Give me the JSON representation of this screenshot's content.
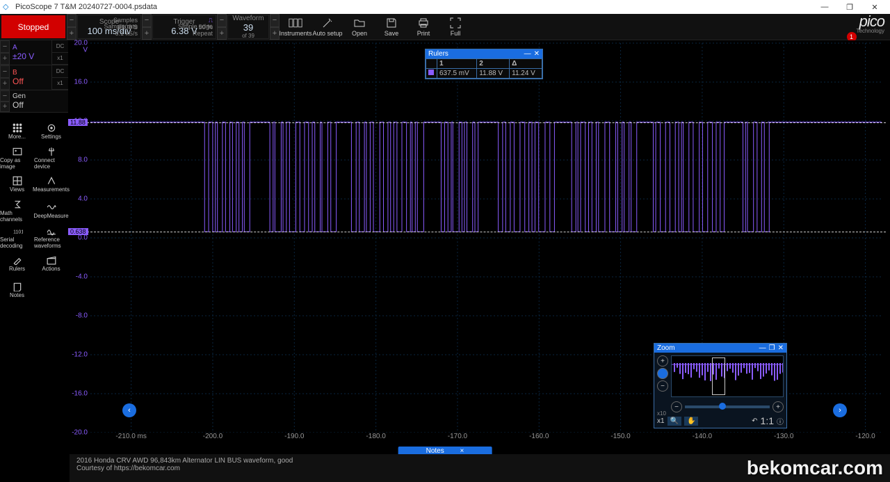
{
  "window": {
    "title": "PicoScope 7 T&M 20240727-0004.psdata",
    "controls": {
      "min": "—",
      "max": "❐",
      "close": "✕"
    }
  },
  "toolbar": {
    "status": "Stopped",
    "scope": {
      "title": "Scope",
      "value": "100 ms/div",
      "samples_lbl": "Samples",
      "samples": "6108 S",
      "rate_lbl": "Sample rate",
      "rate": "6.1 kS/s"
    },
    "trigger": {
      "title": "Trigger",
      "value": "6.38 V",
      "pct": "50 %",
      "edge": "Simple edge",
      "repeat": "Repeat"
    },
    "waveform": {
      "title": "Waveform",
      "value": "39",
      "of": "of 39"
    },
    "buttons": {
      "instruments": "Instruments",
      "autosetup": "Auto setup",
      "open": "Open",
      "save": "Save",
      "print": "Print",
      "full": "Full"
    },
    "logo": "pico",
    "logo_sub": "Technology",
    "badge": "1"
  },
  "channels": {
    "A": {
      "name": "A",
      "range": "±20 V",
      "coupling": "DC",
      "x": "x1"
    },
    "B": {
      "name": "B",
      "range": "Off",
      "coupling": "DC",
      "x": "x1"
    },
    "Gen": {
      "name": "Gen",
      "state": "Off"
    }
  },
  "sidebar": {
    "more": "More...",
    "settings": "Settings",
    "copy": "Copy as image",
    "connect": "Connect device",
    "views": "Views",
    "measurements": "Measurements",
    "math": "Math channels",
    "deep": "DeepMeasure",
    "serial": "Serial decoding",
    "refwave": "Reference waveforms",
    "rulers": "Rulers",
    "actions": "Actions",
    "notes": "Notes"
  },
  "chart_data": {
    "type": "line",
    "title": "",
    "series_name": "Channel A",
    "color": "#8a5cff",
    "y_unit": "V",
    "x_unit": "ms",
    "y_ticks": [
      20.0,
      16.0,
      12.0,
      8.0,
      4.0,
      0.0,
      -4.0,
      -8.0,
      -12.0,
      -16.0,
      -20.0
    ],
    "y_unit_label": "V",
    "x_ticks": [
      -210.0,
      -200.0,
      -190.0,
      -180.0,
      -170.0,
      -160.0,
      -150.0,
      -140.0,
      -130.0,
      -120.0
    ],
    "x_unit_label": "ms",
    "ylim": [
      -20.0,
      20.0
    ],
    "xlim": [
      -215.0,
      -118.0
    ],
    "high_level": 11.88,
    "low_level": 0.638,
    "ruler1": {
      "label": "0.638",
      "value": 0.638
    },
    "ruler2": {
      "label": "11.88",
      "value": 11.88
    }
  },
  "rulers_panel": {
    "title": "Rulers",
    "close": "✕",
    "min": "—",
    "headers": [
      "",
      "1",
      "2",
      "Δ"
    ],
    "row": [
      "637.5 mV",
      "11.88 V",
      "11.24 V"
    ]
  },
  "zoom_panel": {
    "title": "Zoom",
    "close": "✕",
    "min": "—",
    "dock": "❐",
    "x1": "x1",
    "x10": "x10",
    "ratio": "1:1",
    "undo": "↶",
    "info": "ⓘ"
  },
  "notes_tab": {
    "label": "Notes",
    "close": "×"
  },
  "footer": {
    "line1": "2016 Honda CRV AWD 96,843km Alternator LIN BUS waveform, good",
    "line2": "Courtesy of https://bekomcar.com"
  },
  "watermark": "bekomcar.com"
}
